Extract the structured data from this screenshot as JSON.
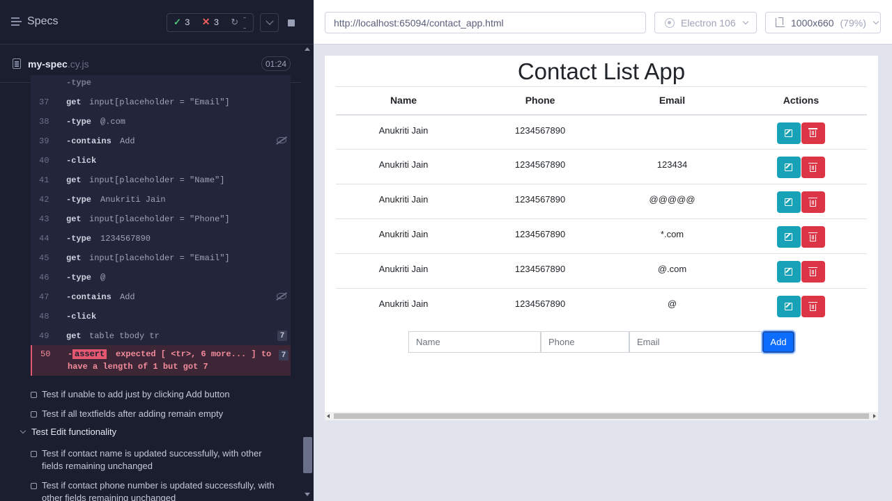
{
  "reporter": {
    "specs_label": "Specs",
    "stats": {
      "passed": "3",
      "failed": "3",
      "pending": "--"
    },
    "spec": {
      "name": "my-spec",
      "ext": ".cy.js",
      "duration": "01:24"
    },
    "commands": [
      {
        "ln": "37",
        "cmd": "get",
        "child": false,
        "arg": "input[placeholder = \"Email\"]"
      },
      {
        "ln": "38",
        "cmd": "type",
        "child": true,
        "arg": "@.com"
      },
      {
        "ln": "39",
        "cmd": "contains",
        "child": true,
        "arg": "Add"
      },
      {
        "ln": "40",
        "cmd": "click",
        "child": true,
        "arg": ""
      },
      {
        "ln": "41",
        "cmd": "get",
        "child": false,
        "arg": "input[placeholder = \"Name\"]"
      },
      {
        "ln": "42",
        "cmd": "type",
        "child": true,
        "arg": "Anukriti Jain"
      },
      {
        "ln": "43",
        "cmd": "get",
        "child": false,
        "arg": "input[placeholder = \"Phone\"]"
      },
      {
        "ln": "44",
        "cmd": "type",
        "child": true,
        "arg": "1234567890"
      },
      {
        "ln": "45",
        "cmd": "get",
        "child": false,
        "arg": "input[placeholder = \"Email\"]"
      },
      {
        "ln": "46",
        "cmd": "type",
        "child": true,
        "arg": "@"
      },
      {
        "ln": "47",
        "cmd": "contains",
        "child": true,
        "arg": "Add"
      },
      {
        "ln": "48",
        "cmd": "click",
        "child": true,
        "arg": ""
      },
      {
        "ln": "49",
        "cmd": "get",
        "child": false,
        "arg": "table tbody tr",
        "count": "7"
      }
    ],
    "failure": {
      "ln": "50",
      "tag": "assert",
      "line1": "expected [ <tr>, 6 more... ] to",
      "line2": "have a length of 1 but got 7",
      "count": "7"
    },
    "tests": [
      "Test if unable to add just by clicking Add button",
      "Test if all textfields after adding remain empty"
    ],
    "suite": "Test Edit functionality",
    "suite_tests": [
      "Test if contact name is updated successfully, with other fields remaining unchanged",
      "Test if contact phone number is updated successfully, with other fields remaining unchanged"
    ]
  },
  "aut": {
    "url": "http://localhost:65094/contact_app.html",
    "browser": "Electron 106",
    "viewport": "1000x660",
    "zoom": "(79%)",
    "app": {
      "title": "Contact List App",
      "columns": [
        "Name",
        "Phone",
        "Email",
        "Actions"
      ],
      "rows": [
        {
          "name": "Anukriti Jain",
          "phone": "1234567890",
          "email": ""
        },
        {
          "name": "Anukriti Jain",
          "phone": "1234567890",
          "email": "123434"
        },
        {
          "name": "Anukriti Jain",
          "phone": "1234567890",
          "email": "@@@@@"
        },
        {
          "name": "Anukriti Jain",
          "phone": "1234567890",
          "email": "*.com"
        },
        {
          "name": "Anukriti Jain",
          "phone": "1234567890",
          "email": "@.com"
        },
        {
          "name": "Anukriti Jain",
          "phone": "1234567890",
          "email": "@"
        }
      ],
      "form": {
        "name_placeholder": "Name",
        "phone_placeholder": "Phone",
        "email_placeholder": "Email",
        "add_label": "Add"
      }
    }
  },
  "colors": {
    "pass": "#4ec57e",
    "fail": "#f15c5c",
    "edit_button": "#17a2b8",
    "delete_button": "#dc3545",
    "add_button": "#0d6efd"
  }
}
